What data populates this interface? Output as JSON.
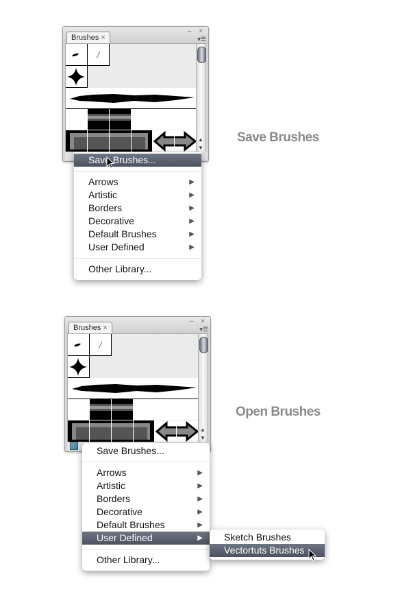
{
  "captions": {
    "save": "Save Brushes",
    "open": "Open Brushes"
  },
  "panel": {
    "tab_label": "Brushes",
    "tab_close": "×",
    "win_controls": "– ×",
    "flyout_icon": "▾☰"
  },
  "menu1": {
    "items": [
      {
        "label": "Save Brushes...",
        "submenu": false,
        "highlighted": true
      },
      {
        "label": "Arrows",
        "submenu": true
      },
      {
        "label": "Artistic",
        "submenu": true
      },
      {
        "label": "Borders",
        "submenu": true
      },
      {
        "label": "Decorative",
        "submenu": true
      },
      {
        "label": "Default Brushes",
        "submenu": true
      },
      {
        "label": "User Defined",
        "submenu": true
      },
      {
        "label": "Other Library...",
        "submenu": false
      }
    ]
  },
  "menu2": {
    "items": [
      {
        "label": "Save Brushes...",
        "submenu": false
      },
      {
        "label": "Arrows",
        "submenu": true
      },
      {
        "label": "Artistic",
        "submenu": true
      },
      {
        "label": "Borders",
        "submenu": true
      },
      {
        "label": "Decorative",
        "submenu": true
      },
      {
        "label": "Default Brushes",
        "submenu": true
      },
      {
        "label": "User Defined",
        "submenu": true,
        "highlighted": true
      },
      {
        "label": "Other Library...",
        "submenu": false
      }
    ],
    "submenu_items": [
      {
        "label": "Sketch Brushes"
      },
      {
        "label": "Vectortuts Brushes",
        "highlighted": true
      }
    ]
  },
  "submenu_arrow": "▶"
}
